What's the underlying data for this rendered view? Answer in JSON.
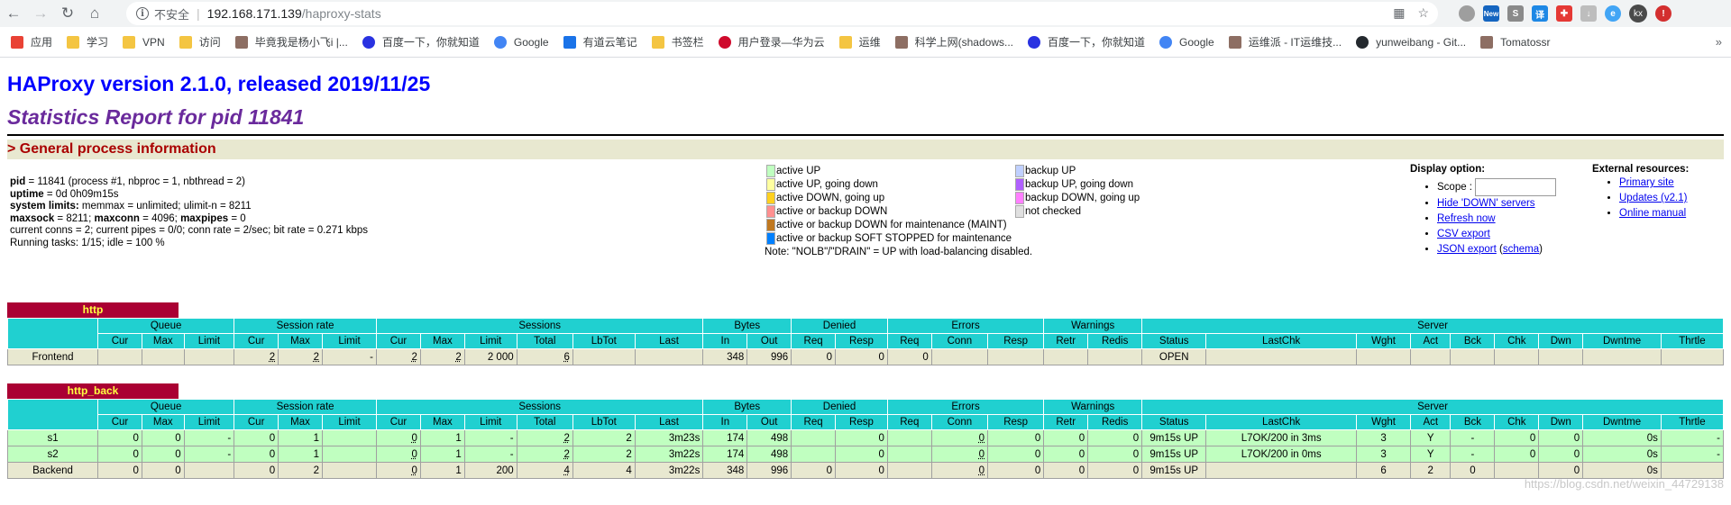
{
  "browser": {
    "security_label": "不安全",
    "url_host": "192.168.171.139",
    "url_path": "/haproxy-stats",
    "bookmarks": [
      {
        "label": "应用",
        "icon": "apps-icon"
      },
      {
        "label": "学习",
        "icon": "folder-icon"
      },
      {
        "label": "VPN",
        "icon": "folder-icon"
      },
      {
        "label": "访问",
        "icon": "folder-icon"
      },
      {
        "label": "毕竟我是杨小飞i |...",
        "icon": "bookmark-icon"
      },
      {
        "label": "百度一下，你就知道",
        "icon": "baidu-icon"
      },
      {
        "label": "Google",
        "icon": "google-icon"
      },
      {
        "label": "有道云笔记",
        "icon": "youdao-icon"
      },
      {
        "label": "书签栏",
        "icon": "folder-icon"
      },
      {
        "label": "用户登录—华为云",
        "icon": "huawei-icon"
      },
      {
        "label": "运维",
        "icon": "folder-icon"
      },
      {
        "label": "科学上网(shadows...",
        "icon": "bookmark-icon"
      },
      {
        "label": "百度一下，你就知道",
        "icon": "baidu-icon"
      },
      {
        "label": "Google",
        "icon": "google-icon"
      },
      {
        "label": "运维派 - IT运维技...",
        "icon": "bookmark-icon"
      },
      {
        "label": "yunweibang - Git...",
        "icon": "github-icon"
      },
      {
        "label": "Tomatossr",
        "icon": "bookmark-icon"
      }
    ],
    "avatar_initials": "kx",
    "ext_badge": "New"
  },
  "page": {
    "title": "HAProxy version 2.1.0, released 2019/11/25",
    "subtitle": "Statistics Report for pid 11841",
    "general_heading": "> General process information"
  },
  "process_info": {
    "line1_key": "pid",
    "line1_val": " = 11841 (process #1, nbproc = 1, nbthread = 2)",
    "line2_key": "uptime",
    "line2_val": " = 0d 0h09m15s",
    "line3_key": "system limits:",
    "line3_val": " memmax = unlimited; ulimit-n = 8211",
    "line4_k1": "maxsock",
    "line4_v1": " = 8211; ",
    "line4_k2": "maxconn",
    "line4_v2": " = 4096; ",
    "line4_k3": "maxpipes",
    "line4_v3": " = 0",
    "line5": "current conns = 2; current pipes = 0/0; conn rate = 2/sec; bit rate = 0.271 kbps",
    "line6": "Running tasks: 1/15; idle = 100 %"
  },
  "legend": {
    "left": [
      {
        "label": "active UP",
        "color": "#c0ffc0"
      },
      {
        "label": "active UP, going down",
        "color": "#ffffa0"
      },
      {
        "label": "active DOWN, going up",
        "color": "#ffd020"
      },
      {
        "label": "active or backup DOWN",
        "color": "#ff9090"
      },
      {
        "label": "active or backup DOWN for maintenance (MAINT)",
        "color": "#c07820"
      },
      {
        "label": "active or backup SOFT STOPPED for maintenance",
        "color": "#0080ff"
      }
    ],
    "right": [
      {
        "label": "backup UP",
        "color": "#c0d0ff"
      },
      {
        "label": "backup UP, going down",
        "color": "#b060ff"
      },
      {
        "label": "backup DOWN, going up",
        "color": "#ff80ff"
      },
      {
        "label": "not checked",
        "color": "#e0e0e0"
      }
    ],
    "note": "Note: \"NOLB\"/\"DRAIN\" = UP with load-balancing disabled."
  },
  "display_options": {
    "heading": "Display option:",
    "scope_label": "Scope :",
    "links": [
      "Hide 'DOWN' servers",
      "Refresh now",
      "CSV export",
      "JSON export"
    ],
    "schema_prefix": "(",
    "schema_link": "schema",
    "schema_suffix": ")"
  },
  "external_resources": {
    "heading": "External resources:",
    "links": [
      "Primary site",
      "Updates (v2.1)",
      "Online manual"
    ]
  },
  "table_headers": {
    "groups": [
      "Queue",
      "Session rate",
      "Sessions",
      "Bytes",
      "Denied",
      "Errors",
      "Warnings",
      "Server"
    ],
    "queue": [
      "Cur",
      "Max",
      "Limit"
    ],
    "rate": [
      "Cur",
      "Max",
      "Limit"
    ],
    "sessions": [
      "Cur",
      "Max",
      "Limit",
      "Total",
      "LbTot",
      "Last"
    ],
    "bytes": [
      "In",
      "Out"
    ],
    "denied": [
      "Req",
      "Resp"
    ],
    "errors": [
      "Req",
      "Conn",
      "Resp"
    ],
    "warnings": [
      "Retr",
      "Redis"
    ],
    "server": [
      "Status",
      "LastChk",
      "Wght",
      "Act",
      "Bck",
      "Chk",
      "Dwn",
      "Dwntme",
      "Thrtle"
    ]
  },
  "proxies": [
    {
      "name": "http",
      "rows": [
        {
          "kind": "frontend",
          "cells": [
            "Frontend",
            "",
            "",
            "",
            "2",
            "2",
            "-",
            "2",
            "2",
            "2 000",
            "6",
            "",
            "",
            "348",
            "996",
            "0",
            "0",
            "0",
            "",
            "",
            "",
            "",
            "OPEN",
            "",
            "",
            "",
            "",
            "",
            "",
            "",
            ""
          ]
        }
      ]
    },
    {
      "name": "http_back",
      "rows": [
        {
          "kind": "up",
          "cells": [
            "s1",
            "0",
            "0",
            "-",
            "0",
            "1",
            "",
            "0",
            "1",
            "-",
            "2",
            "2",
            "3m23s",
            "174",
            "498",
            "",
            "0",
            "",
            "0",
            "0",
            "0",
            "0",
            "9m15s UP",
            "L7OK/200 in 3ms",
            "3",
            "Y",
            "-",
            "0",
            "0",
            "0s",
            "-"
          ]
        },
        {
          "kind": "up",
          "cells": [
            "s2",
            "0",
            "0",
            "-",
            "0",
            "1",
            "",
            "0",
            "1",
            "-",
            "2",
            "2",
            "3m22s",
            "174",
            "498",
            "",
            "0",
            "",
            "0",
            "0",
            "0",
            "0",
            "9m15s UP",
            "L7OK/200 in 0ms",
            "3",
            "Y",
            "-",
            "0",
            "0",
            "0s",
            "-"
          ]
        },
        {
          "kind": "backend",
          "cells": [
            "Backend",
            "0",
            "0",
            "",
            "0",
            "2",
            "",
            "0",
            "1",
            "200",
            "4",
            "4",
            "3m22s",
            "348",
            "996",
            "0",
            "0",
            "",
            "0",
            "0",
            "0",
            "0",
            "9m15s UP",
            "",
            "6",
            "2",
            "0",
            "",
            "0",
            "0s",
            ""
          ]
        }
      ]
    }
  ],
  "watermark": "https://blog.csdn.net/weixin_44729138"
}
